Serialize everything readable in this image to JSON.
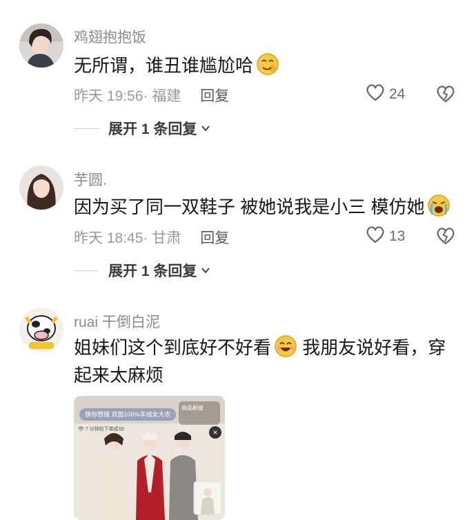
{
  "comments": [
    {
      "username": "鸡翅抱抱饭",
      "text": "无所谓，谁丑谁尴尬哈",
      "emoji": "smirk-emoji",
      "time": "昨天 19:56",
      "location": "· 福建",
      "reply_label": "回复",
      "likes": "24",
      "expand_label": "展开 1 条回复"
    },
    {
      "username": "芋圆.",
      "text": "因为买了同一双鞋子 被她说我是小三 模仿她",
      "emoji": "crying-emoji",
      "time": "昨天 18:45",
      "location": "· 甘肃",
      "reply_label": "回复",
      "likes": "13",
      "expand_label": "展开 1 条回复"
    },
    {
      "username": "ruai 干倒白泥",
      "text_before": "姐妹们这个到底好不好看",
      "emoji": "grin-emoji",
      "text_after": " 我朋友说好看，穿起来太麻烦"
    }
  ],
  "screenshot": {
    "search_bar": "猜你想搜 双面100%羊绒女大衣",
    "store_label": "商品橱窗",
    "note": "👁 7 分钟前下单成功!",
    "close_icon": "close-icon"
  },
  "colors": {
    "coat_cream": "#efe6d6",
    "coat_red": "#b3202a",
    "coat_grey": "#8a8784",
    "emoji_yellow": "#f7c842"
  }
}
